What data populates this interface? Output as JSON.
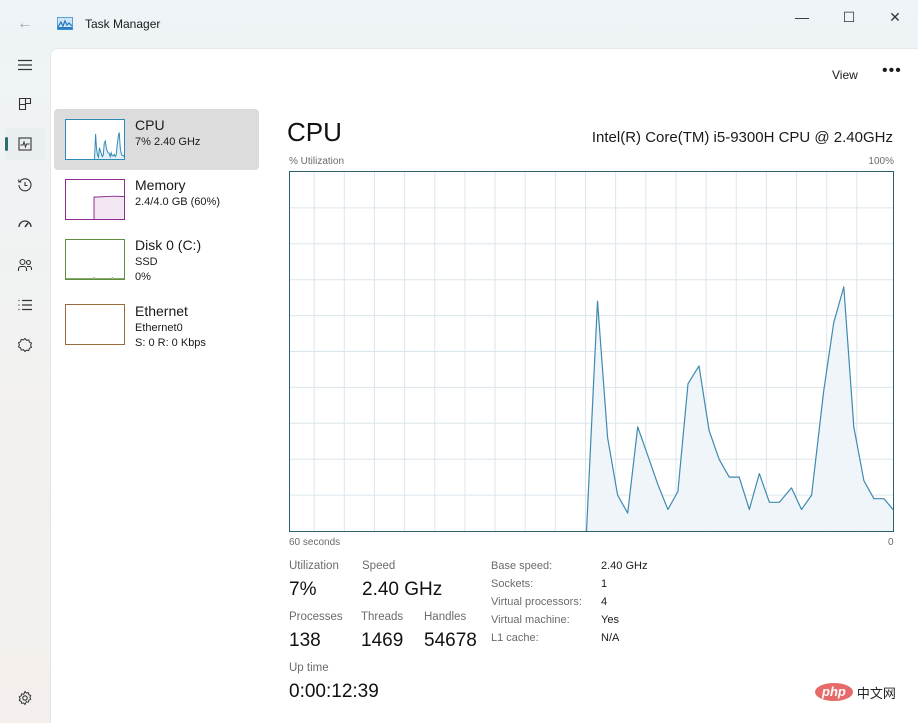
{
  "titlebar": {
    "title": "Task Manager",
    "back_icon": "arrow-left-icon",
    "minimize_glyph": "—",
    "maximize_glyph": "☐",
    "close_glyph": "✕"
  },
  "nav": {
    "items": [
      {
        "name": "hamburger-menu",
        "icon": "hamburger-icon"
      },
      {
        "name": "processes",
        "icon": "processes-grid-icon"
      },
      {
        "name": "performance",
        "icon": "performance-chart-icon",
        "active": true
      },
      {
        "name": "app-history",
        "icon": "history-clock-icon"
      },
      {
        "name": "startup-apps",
        "icon": "speedometer-icon"
      },
      {
        "name": "users",
        "icon": "users-icon"
      },
      {
        "name": "details",
        "icon": "list-icon"
      },
      {
        "name": "services",
        "icon": "puzzle-gear-icon"
      }
    ],
    "settings_icon": "settings-gear-icon"
  },
  "command_bar": {
    "view_label": "View",
    "more_label": "•••"
  },
  "perf_list": [
    {
      "name": "CPU",
      "sub1": "7% 2.40 GHz",
      "sub2": "",
      "color": "#2f89b5",
      "selected": true
    },
    {
      "name": "Memory",
      "sub1": "2.4/4.0 GB (60%)",
      "sub2": "",
      "color": "#8b2c8f",
      "selected": false
    },
    {
      "name": "Disk 0 (C:)",
      "sub1": "SSD",
      "sub2": "0%",
      "color": "#5f8d3e",
      "selected": false
    },
    {
      "name": "Ethernet",
      "sub1": "Ethernet0",
      "sub2": "S: 0 R: 0 Kbps",
      "color": "#9a6a3a",
      "selected": false
    }
  ],
  "main": {
    "title": "CPU",
    "model": "Intel(R) Core(TM) i5-9300H CPU @ 2.40GHz",
    "y_label": "% Utilization",
    "y_max_label": "100%",
    "x_left_label": "60 seconds",
    "x_right_label": "0"
  },
  "stats": {
    "utilization_label": "Utilization",
    "utilization_value": "7%",
    "speed_label": "Speed",
    "speed_value": "2.40 GHz",
    "processes_label": "Processes",
    "processes_value": "138",
    "threads_label": "Threads",
    "threads_value": "1469",
    "handles_label": "Handles",
    "handles_value": "54678",
    "uptime_label": "Up time",
    "uptime_value": "0:00:12:39"
  },
  "details": [
    {
      "key": "Base speed:",
      "value": "2.40 GHz"
    },
    {
      "key": "Sockets:",
      "value": "1"
    },
    {
      "key": "Virtual processors:",
      "value": "4"
    },
    {
      "key": "Virtual machine:",
      "value": "Yes"
    },
    {
      "key": "L1 cache:",
      "value": "N/A"
    }
  ],
  "watermark": {
    "pill": "php",
    "text": "中文网"
  },
  "chart_data": {
    "type": "area",
    "title": "CPU",
    "ylabel": "% Utilization",
    "xlabel": "60 seconds",
    "x_range_seconds": [
      60,
      0
    ],
    "ylim": [
      0,
      100
    ],
    "grid": true,
    "line_color": "#3f8ab0",
    "fill_color": "#eef4fa",
    "grid_color": "#dbe6ec",
    "border_color": "#2f5f6f",
    "seconds_ago": [
      30.5,
      29.4,
      28.4,
      27.4,
      26.4,
      25.4,
      24.4,
      23.4,
      22.4,
      21.4,
      20.4,
      19.3,
      18.3,
      17.3,
      16.3,
      15.3,
      14.3,
      13.3,
      12.3,
      11.3,
      10.1,
      9.1,
      8.1,
      6.9,
      5.9,
      4.9,
      3.9,
      2.9,
      1.9,
      0.9,
      0
    ],
    "values": [
      0,
      64,
      26,
      10,
      5,
      29,
      21,
      13,
      6,
      11,
      41,
      46,
      28,
      20,
      15,
      15,
      6,
      16,
      8,
      8,
      12,
      6,
      10,
      39,
      58,
      68,
      29,
      14,
      9,
      9,
      6
    ]
  }
}
